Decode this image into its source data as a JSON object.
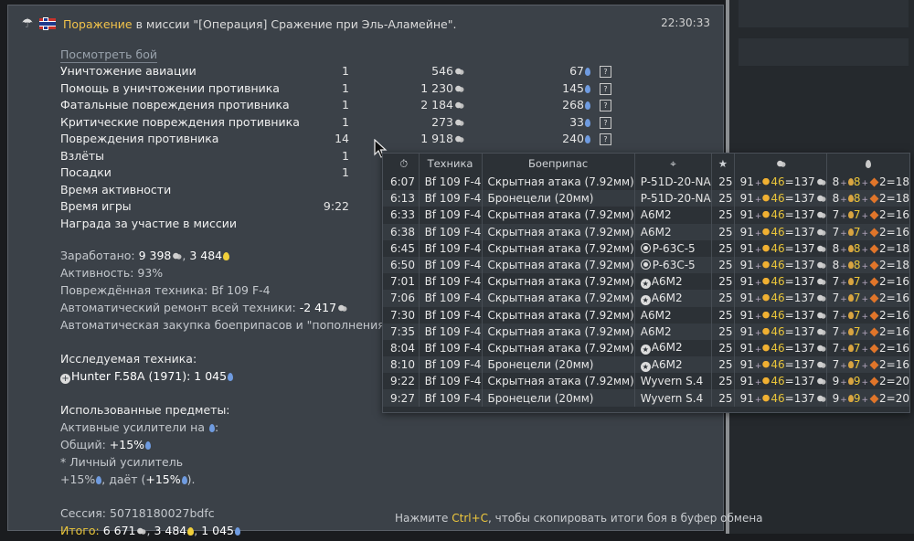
{
  "header": {
    "defeat": "Поражение",
    "mission_text": " в миссии \"[Операция] Сражение при Эль-Аламейне\".",
    "time": "22:30:33"
  },
  "view_battle": "Посмотреть бой",
  "stats": [
    {
      "label": "Уничтожение авиации",
      "count": "1",
      "sl": "546",
      "rp": "67",
      "help": "?"
    },
    {
      "label": "Помощь в уничтожении противника",
      "count": "1",
      "sl": "1 230",
      "rp": "145",
      "help": "?"
    },
    {
      "label": "Фатальные повреждения противника",
      "count": "1",
      "sl": "2 184",
      "rp": "268",
      "help": "?"
    },
    {
      "label": "Критические повреждения противника",
      "count": "1",
      "sl": "273",
      "rp": "33",
      "help": "?"
    },
    {
      "label": "Повреждения противника",
      "count": "14",
      "sl": "1 918",
      "rp": "240",
      "help": "?"
    },
    {
      "label": "Взлёты",
      "count": "1",
      "sl": "",
      "rp": "",
      "help": ""
    },
    {
      "label": "Посадки",
      "count": "1",
      "sl": "",
      "rp": "",
      "help": ""
    },
    {
      "label": "Время активности",
      "count": "",
      "sl": "",
      "rp": "",
      "help": ""
    },
    {
      "label": "Время игры",
      "count": "9:22",
      "sl": "",
      "rp": "",
      "help": ""
    },
    {
      "label": "Награда за участие в миссии",
      "count": "",
      "sl": "",
      "rp": "",
      "help": ""
    }
  ],
  "info": {
    "earned_label": "Заработано: ",
    "earned_sl": "9 398",
    "earned_gold": "3 484",
    "activity": "Активность: 93%",
    "damaged_vehicle": "Повреждённая техника: Bf 109 F-4",
    "auto_repair_label": "Автоматический ремонт всей техники: ",
    "auto_repair_value": "-2 417",
    "auto_purchase": "Автоматическая закупка боеприпасов и \"пополнения экипажа\"",
    "research_header": "Исследуемая техника:",
    "research_vehicle": "Hunter F.58A (1971): ",
    "research_rp": "1 045",
    "items_header": "Использованные предметы:",
    "boosters_label": "Активные усилители на ",
    "boosters_colon": ":",
    "general_label": "Общий: ",
    "general_value": "+15%",
    "personal_label": "* Личный усилитель",
    "personal_value": "+15%",
    "personal_gives": ", даёт (",
    "personal_gives_value": "+15%",
    "personal_end": ").",
    "session": "Сессия: 50718180027bdfc",
    "total_label": "Итого: ",
    "total_sl": "6 671",
    "total_gold": "3 484",
    "total_rp": "1 045"
  },
  "footer_hint": {
    "pre": "Нажмите ",
    "key": "Ctrl+C",
    "post": ", чтобы скопировать итоги боя в буфер обмена"
  },
  "popup": {
    "columns": {
      "time_icon": "clock-icon",
      "vehicle": "Техника",
      "ammo": "Боеприпас",
      "target_icon": "crosshair-icon",
      "star": "★",
      "sl_icon": "silver-lions-icon",
      "rp_icon": "research-points-icon"
    },
    "rows": [
      {
        "time": "6:07",
        "vehicle": "Bf 109 F-4",
        "ammo": "Скрытная атака (7.92мм)",
        "target": "P-51D-20-NA",
        "target_icon": "",
        "score": "25",
        "sl_base": "91",
        "sl_bonus": "46",
        "sl_total": "=137",
        "rp_base": "8",
        "rp_b1": "8",
        "rp_b2": "2",
        "rp_total": "=18"
      },
      {
        "time": "6:13",
        "vehicle": "Bf 109 F-4",
        "ammo": "Бронецели (20мм)",
        "target": "P-51D-20-NA",
        "target_icon": "",
        "score": "25",
        "sl_base": "91",
        "sl_bonus": "46",
        "sl_total": "=137",
        "rp_base": "8",
        "rp_b1": "8",
        "rp_b2": "2",
        "rp_total": "=18"
      },
      {
        "time": "6:33",
        "vehicle": "Bf 109 F-4",
        "ammo": "Скрытная атака (7.92мм)",
        "target": "A6M2",
        "target_icon": "",
        "score": "25",
        "sl_base": "91",
        "sl_bonus": "46",
        "sl_total": "=137",
        "rp_base": "7",
        "rp_b1": "7",
        "rp_b2": "2",
        "rp_total": "=16"
      },
      {
        "time": "6:38",
        "vehicle": "Bf 109 F-4",
        "ammo": "Скрытная атака (7.92мм)",
        "target": "A6M2",
        "target_icon": "",
        "score": "25",
        "sl_base": "91",
        "sl_bonus": "46",
        "sl_total": "=137",
        "rp_base": "7",
        "rp_b1": "7",
        "rp_b2": "2",
        "rp_total": "=16"
      },
      {
        "time": "6:45",
        "vehicle": "Bf 109 F-4",
        "ammo": "Скрытная атака (7.92мм)",
        "target": "P-63C-5",
        "target_icon": "target",
        "score": "25",
        "sl_base": "91",
        "sl_bonus": "46",
        "sl_total": "=137",
        "rp_base": "8",
        "rp_b1": "8",
        "rp_b2": "2",
        "rp_total": "=18"
      },
      {
        "time": "6:50",
        "vehicle": "Bf 109 F-4",
        "ammo": "Скрытная атака (7.92мм)",
        "target": "P-63C-5",
        "target_icon": "target",
        "score": "25",
        "sl_base": "91",
        "sl_bonus": "46",
        "sl_total": "=137",
        "rp_base": "8",
        "rp_b1": "8",
        "rp_b2": "2",
        "rp_total": "=18"
      },
      {
        "time": "7:01",
        "vehicle": "Bf 109 F-4",
        "ammo": "Скрытная атака (7.92мм)",
        "target": "A6M2",
        "target_icon": "star",
        "score": "25",
        "sl_base": "91",
        "sl_bonus": "46",
        "sl_total": "=137",
        "rp_base": "7",
        "rp_b1": "7",
        "rp_b2": "2",
        "rp_total": "=16"
      },
      {
        "time": "7:06",
        "vehicle": "Bf 109 F-4",
        "ammo": "Скрытная атака (7.92мм)",
        "target": "A6M2",
        "target_icon": "star",
        "score": "25",
        "sl_base": "91",
        "sl_bonus": "46",
        "sl_total": "=137",
        "rp_base": "7",
        "rp_b1": "7",
        "rp_b2": "2",
        "rp_total": "=16"
      },
      {
        "time": "7:30",
        "vehicle": "Bf 109 F-4",
        "ammo": "Скрытная атака (7.92мм)",
        "target": "A6M2",
        "target_icon": "",
        "score": "25",
        "sl_base": "91",
        "sl_bonus": "46",
        "sl_total": "=137",
        "rp_base": "7",
        "rp_b1": "7",
        "rp_b2": "2",
        "rp_total": "=16"
      },
      {
        "time": "7:35",
        "vehicle": "Bf 109 F-4",
        "ammo": "Скрытная атака (7.92мм)",
        "target": "A6M2",
        "target_icon": "",
        "score": "25",
        "sl_base": "91",
        "sl_bonus": "46",
        "sl_total": "=137",
        "rp_base": "7",
        "rp_b1": "7",
        "rp_b2": "2",
        "rp_total": "=16"
      },
      {
        "time": "8:04",
        "vehicle": "Bf 109 F-4",
        "ammo": "Скрытная атака (7.92мм)",
        "target": "A6M2",
        "target_icon": "star",
        "score": "25",
        "sl_base": "91",
        "sl_bonus": "46",
        "sl_total": "=137",
        "rp_base": "7",
        "rp_b1": "7",
        "rp_b2": "2",
        "rp_total": "=16"
      },
      {
        "time": "8:10",
        "vehicle": "Bf 109 F-4",
        "ammo": "Бронецели (20мм)",
        "target": "A6M2",
        "target_icon": "star",
        "score": "25",
        "sl_base": "91",
        "sl_bonus": "46",
        "sl_total": "=137",
        "rp_base": "7",
        "rp_b1": "7",
        "rp_b2": "2",
        "rp_total": "=16"
      },
      {
        "time": "9:22",
        "vehicle": "Bf 109 F-4",
        "ammo": "Скрытная атака (7.92мм)",
        "target": "Wyvern S.4",
        "target_icon": "",
        "score": "25",
        "sl_base": "91",
        "sl_bonus": "46",
        "sl_total": "=137",
        "rp_base": "9",
        "rp_b1": "9",
        "rp_b2": "2",
        "rp_total": "=20"
      },
      {
        "time": "9:27",
        "vehicle": "Bf 109 F-4",
        "ammo": "Бронецели (20мм)",
        "target": "Wyvern S.4",
        "target_icon": "",
        "score": "25",
        "sl_base": "91",
        "sl_bonus": "46",
        "sl_total": "=137",
        "rp_base": "9",
        "rp_b1": "9",
        "rp_b2": "2",
        "rp_total": "=20"
      }
    ]
  }
}
